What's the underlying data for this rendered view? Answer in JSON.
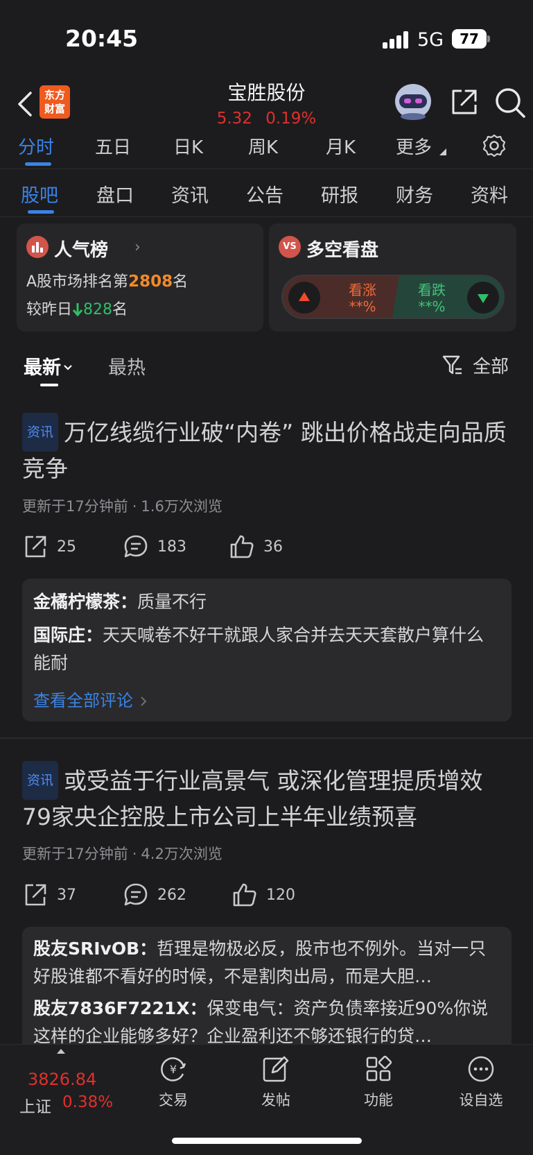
{
  "status_bar": {
    "time": "20:45",
    "network": "5G",
    "battery": "77"
  },
  "header": {
    "logo_line1": "东方",
    "logo_line2": "财富",
    "title": "宝胜股份",
    "price": "5.32",
    "change_pct": "0.19%"
  },
  "chart_tabs": [
    "分时",
    "五日",
    "日K",
    "周K",
    "月K",
    "更多"
  ],
  "section_tabs": [
    "股吧",
    "盘口",
    "资讯",
    "公告",
    "研报",
    "财务",
    "资料"
  ],
  "popularity": {
    "title": "人气榜",
    "rank_prefix": "A股市场排名第",
    "rank": "2808",
    "rank_suffix": "名",
    "change_prefix": "较昨日",
    "change_value": "828",
    "change_suffix": "名"
  },
  "vs": {
    "title": "多空看盘",
    "up_label": "看涨",
    "up_value": "**%",
    "down_label": "看跌",
    "down_value": "**%"
  },
  "feed_filter": {
    "latest": "最新",
    "hot": "最热",
    "all": "全部"
  },
  "posts": [
    {
      "tag": "资讯",
      "title": "万亿线缆行业破“内卷” 跳出价格战走向品质竞争",
      "updated": "更新于17分钟前",
      "dot": "·",
      "views": "1.6万次浏览",
      "shares": "25",
      "comments": "183",
      "likes": "36",
      "top_comments": [
        {
          "user": "金橘柠檬茶：",
          "text": "质量不行"
        },
        {
          "user": "国际庄：",
          "text": "天天喊卷不好干就跟人家合并去天天套散户算什么能耐"
        }
      ],
      "see_all": "查看全部评论"
    },
    {
      "tag": "资讯",
      "title": "或受益于行业高景气 或深化管理提质增效 79家央企控股上市公司上半年业绩预喜",
      "updated": "更新于17分钟前",
      "dot": "·",
      "views": "4.2万次浏览",
      "shares": "37",
      "comments": "262",
      "likes": "120",
      "top_comments": [
        {
          "user": "股友SRIvOB：",
          "text": "哲理是物极必反，股市也不例外。当对一只好股谁都不看好的时候，不是割肉出局，而是大胆…"
        },
        {
          "user": "股友7836F7221X：",
          "text": "保变电气：资产负债率接近90%你说这样的企业能够多好？企业盈利还不够还银行的贷…"
        }
      ]
    }
  ],
  "bottom_bar": {
    "index_value": "3826.84",
    "index_name": "上证",
    "index_pct": "0.38%",
    "nav": [
      "交易",
      "发帖",
      "功能",
      "设自选"
    ]
  },
  "colors": {
    "accent": "#3a83e6",
    "up": "#e0302c",
    "down": "#2fbf6a",
    "rank": "#f28a27"
  }
}
